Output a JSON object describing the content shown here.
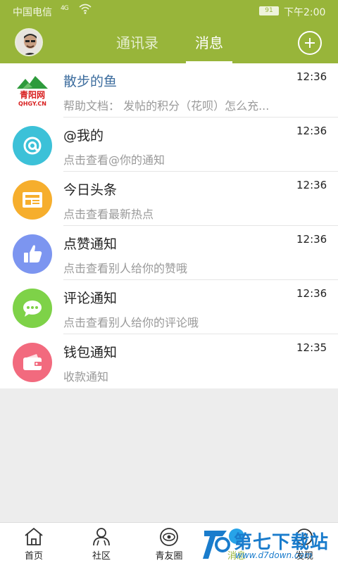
{
  "status_bar": {
    "carrier": "中国电信",
    "signal_label": "4G",
    "battery": "91",
    "time": "下午2:00"
  },
  "header": {
    "tabs": [
      {
        "label": "通讯录",
        "active": false
      },
      {
        "label": "消息",
        "active": true
      }
    ],
    "add_icon": "plus-circle-icon"
  },
  "messages": [
    {
      "title": "散步的鱼",
      "subtitle": "帮助文档： 发帖的积分（花呗）怎么充...",
      "time": "12:36",
      "icon": "qinghe-logo",
      "logo_text": "青阳网",
      "logo_sub": "QHGY.CN"
    },
    {
      "title": "@我的",
      "subtitle": "点击查看@你的通知",
      "time": "12:36",
      "icon": "at-icon",
      "color": "#3cc1d8"
    },
    {
      "title": "今日头条",
      "subtitle": "点击查看最新热点",
      "time": "12:36",
      "icon": "newspaper-icon",
      "color": "#f6ae2d"
    },
    {
      "title": "点赞通知",
      "subtitle": "点击查看别人给你的赞哦",
      "time": "12:36",
      "icon": "thumbs-up-icon",
      "color": "#7c95f0"
    },
    {
      "title": "评论通知",
      "subtitle": "点击查看别人给你的评论哦",
      "time": "12:36",
      "icon": "comment-icon",
      "color": "#7ed248"
    },
    {
      "title": "钱包通知",
      "subtitle": "收款通知",
      "time": "12:35",
      "icon": "wallet-icon",
      "color": "#f26a7e"
    }
  ],
  "bottom_nav": [
    {
      "label": "首页",
      "icon": "home-icon"
    },
    {
      "label": "社区",
      "icon": "community-icon"
    },
    {
      "label": "青友圈",
      "icon": "moments-icon"
    },
    {
      "label": "消息",
      "icon": "message-icon",
      "active": true
    },
    {
      "label": "发现",
      "icon": "discover-icon"
    }
  ],
  "watermark": {
    "text": "第七下载站",
    "url": "www.d7down.com"
  },
  "colors": {
    "brand": "#98b53a"
  }
}
